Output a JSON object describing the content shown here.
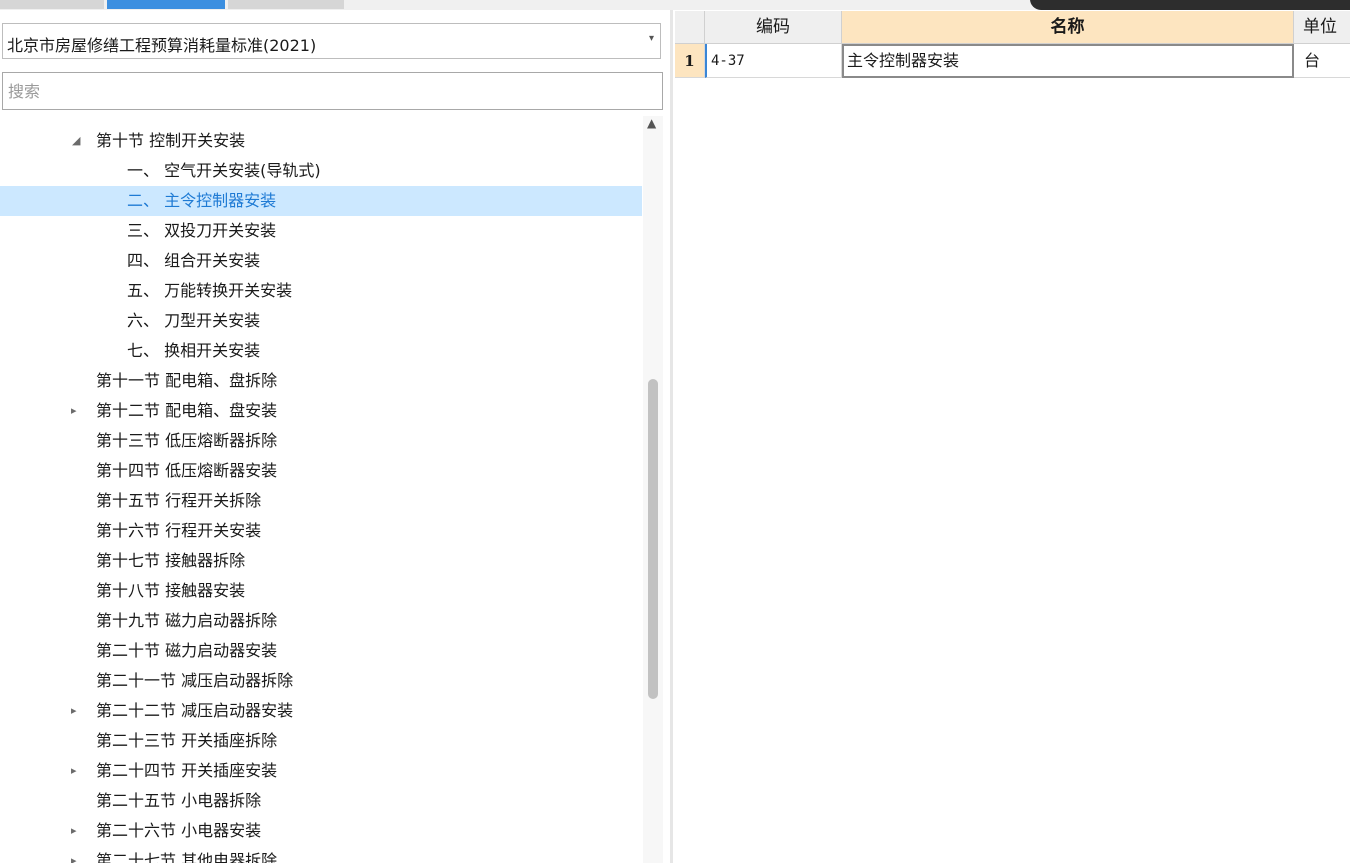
{
  "left_panel": {
    "standard_select": {
      "value": "北京市房屋修缮工程预算消耗量标准(2021)"
    },
    "search": {
      "placeholder": "搜索"
    },
    "tree": [
      {
        "label": "第十节 控制开关安装",
        "level": 1,
        "toggle": "expanded"
      },
      {
        "label": "一、 空气开关安装(导轨式)",
        "level": 2,
        "toggle": "none"
      },
      {
        "label": "二、 主令控制器安装",
        "level": 2,
        "toggle": "none",
        "selected": true
      },
      {
        "label": "三、 双投刀开关安装",
        "level": 2,
        "toggle": "none"
      },
      {
        "label": "四、 组合开关安装",
        "level": 2,
        "toggle": "none"
      },
      {
        "label": "五、 万能转换开关安装",
        "level": 2,
        "toggle": "none"
      },
      {
        "label": "六、 刀型开关安装",
        "level": 2,
        "toggle": "none"
      },
      {
        "label": "七、 换相开关安装",
        "level": 2,
        "toggle": "none"
      },
      {
        "label": "第十一节 配电箱、盘拆除",
        "level": 1,
        "toggle": "none"
      },
      {
        "label": "第十二节 配电箱、盘安装",
        "level": 1,
        "toggle": "collapsed"
      },
      {
        "label": "第十三节 低压熔断器拆除",
        "level": 1,
        "toggle": "none"
      },
      {
        "label": "第十四节 低压熔断器安装",
        "level": 1,
        "toggle": "none"
      },
      {
        "label": "第十五节 行程开关拆除",
        "level": 1,
        "toggle": "none"
      },
      {
        "label": "第十六节 行程开关安装",
        "level": 1,
        "toggle": "none"
      },
      {
        "label": "第十七节 接触器拆除",
        "level": 1,
        "toggle": "none"
      },
      {
        "label": "第十八节 接触器安装",
        "level": 1,
        "toggle": "none"
      },
      {
        "label": "第十九节 磁力启动器拆除",
        "level": 1,
        "toggle": "none"
      },
      {
        "label": "第二十节 磁力启动器安装",
        "level": 1,
        "toggle": "none"
      },
      {
        "label": "第二十一节 减压启动器拆除",
        "level": 1,
        "toggle": "none"
      },
      {
        "label": "第二十二节 减压启动器安装",
        "level": 1,
        "toggle": "collapsed"
      },
      {
        "label": "第二十三节 开关插座拆除",
        "level": 1,
        "toggle": "none"
      },
      {
        "label": "第二十四节 开关插座安装",
        "level": 1,
        "toggle": "collapsed"
      },
      {
        "label": "第二十五节 小电器拆除",
        "level": 1,
        "toggle": "none"
      },
      {
        "label": "第二十六节 小电器安装",
        "level": 1,
        "toggle": "collapsed"
      },
      {
        "label": "第二十七节 其他电器拆除",
        "level": 1,
        "toggle": "collapsed"
      }
    ],
    "icons": {
      "expanded": "◢",
      "collapsed": "▸",
      "dropdown": "▾",
      "scroll_up": "▲"
    }
  },
  "grid": {
    "columns": {
      "code": "编码",
      "name": "名称",
      "unit": "单位"
    },
    "rows": [
      {
        "num": "1",
        "code": "4-37",
        "name": "主令控制器安装",
        "unit": "台"
      }
    ]
  },
  "colors": {
    "selection_bg": "#cce8ff",
    "selection_text": "#1e7ad4",
    "header_highlight": "#fde5c0",
    "active_tab": "#3c8fe0"
  }
}
